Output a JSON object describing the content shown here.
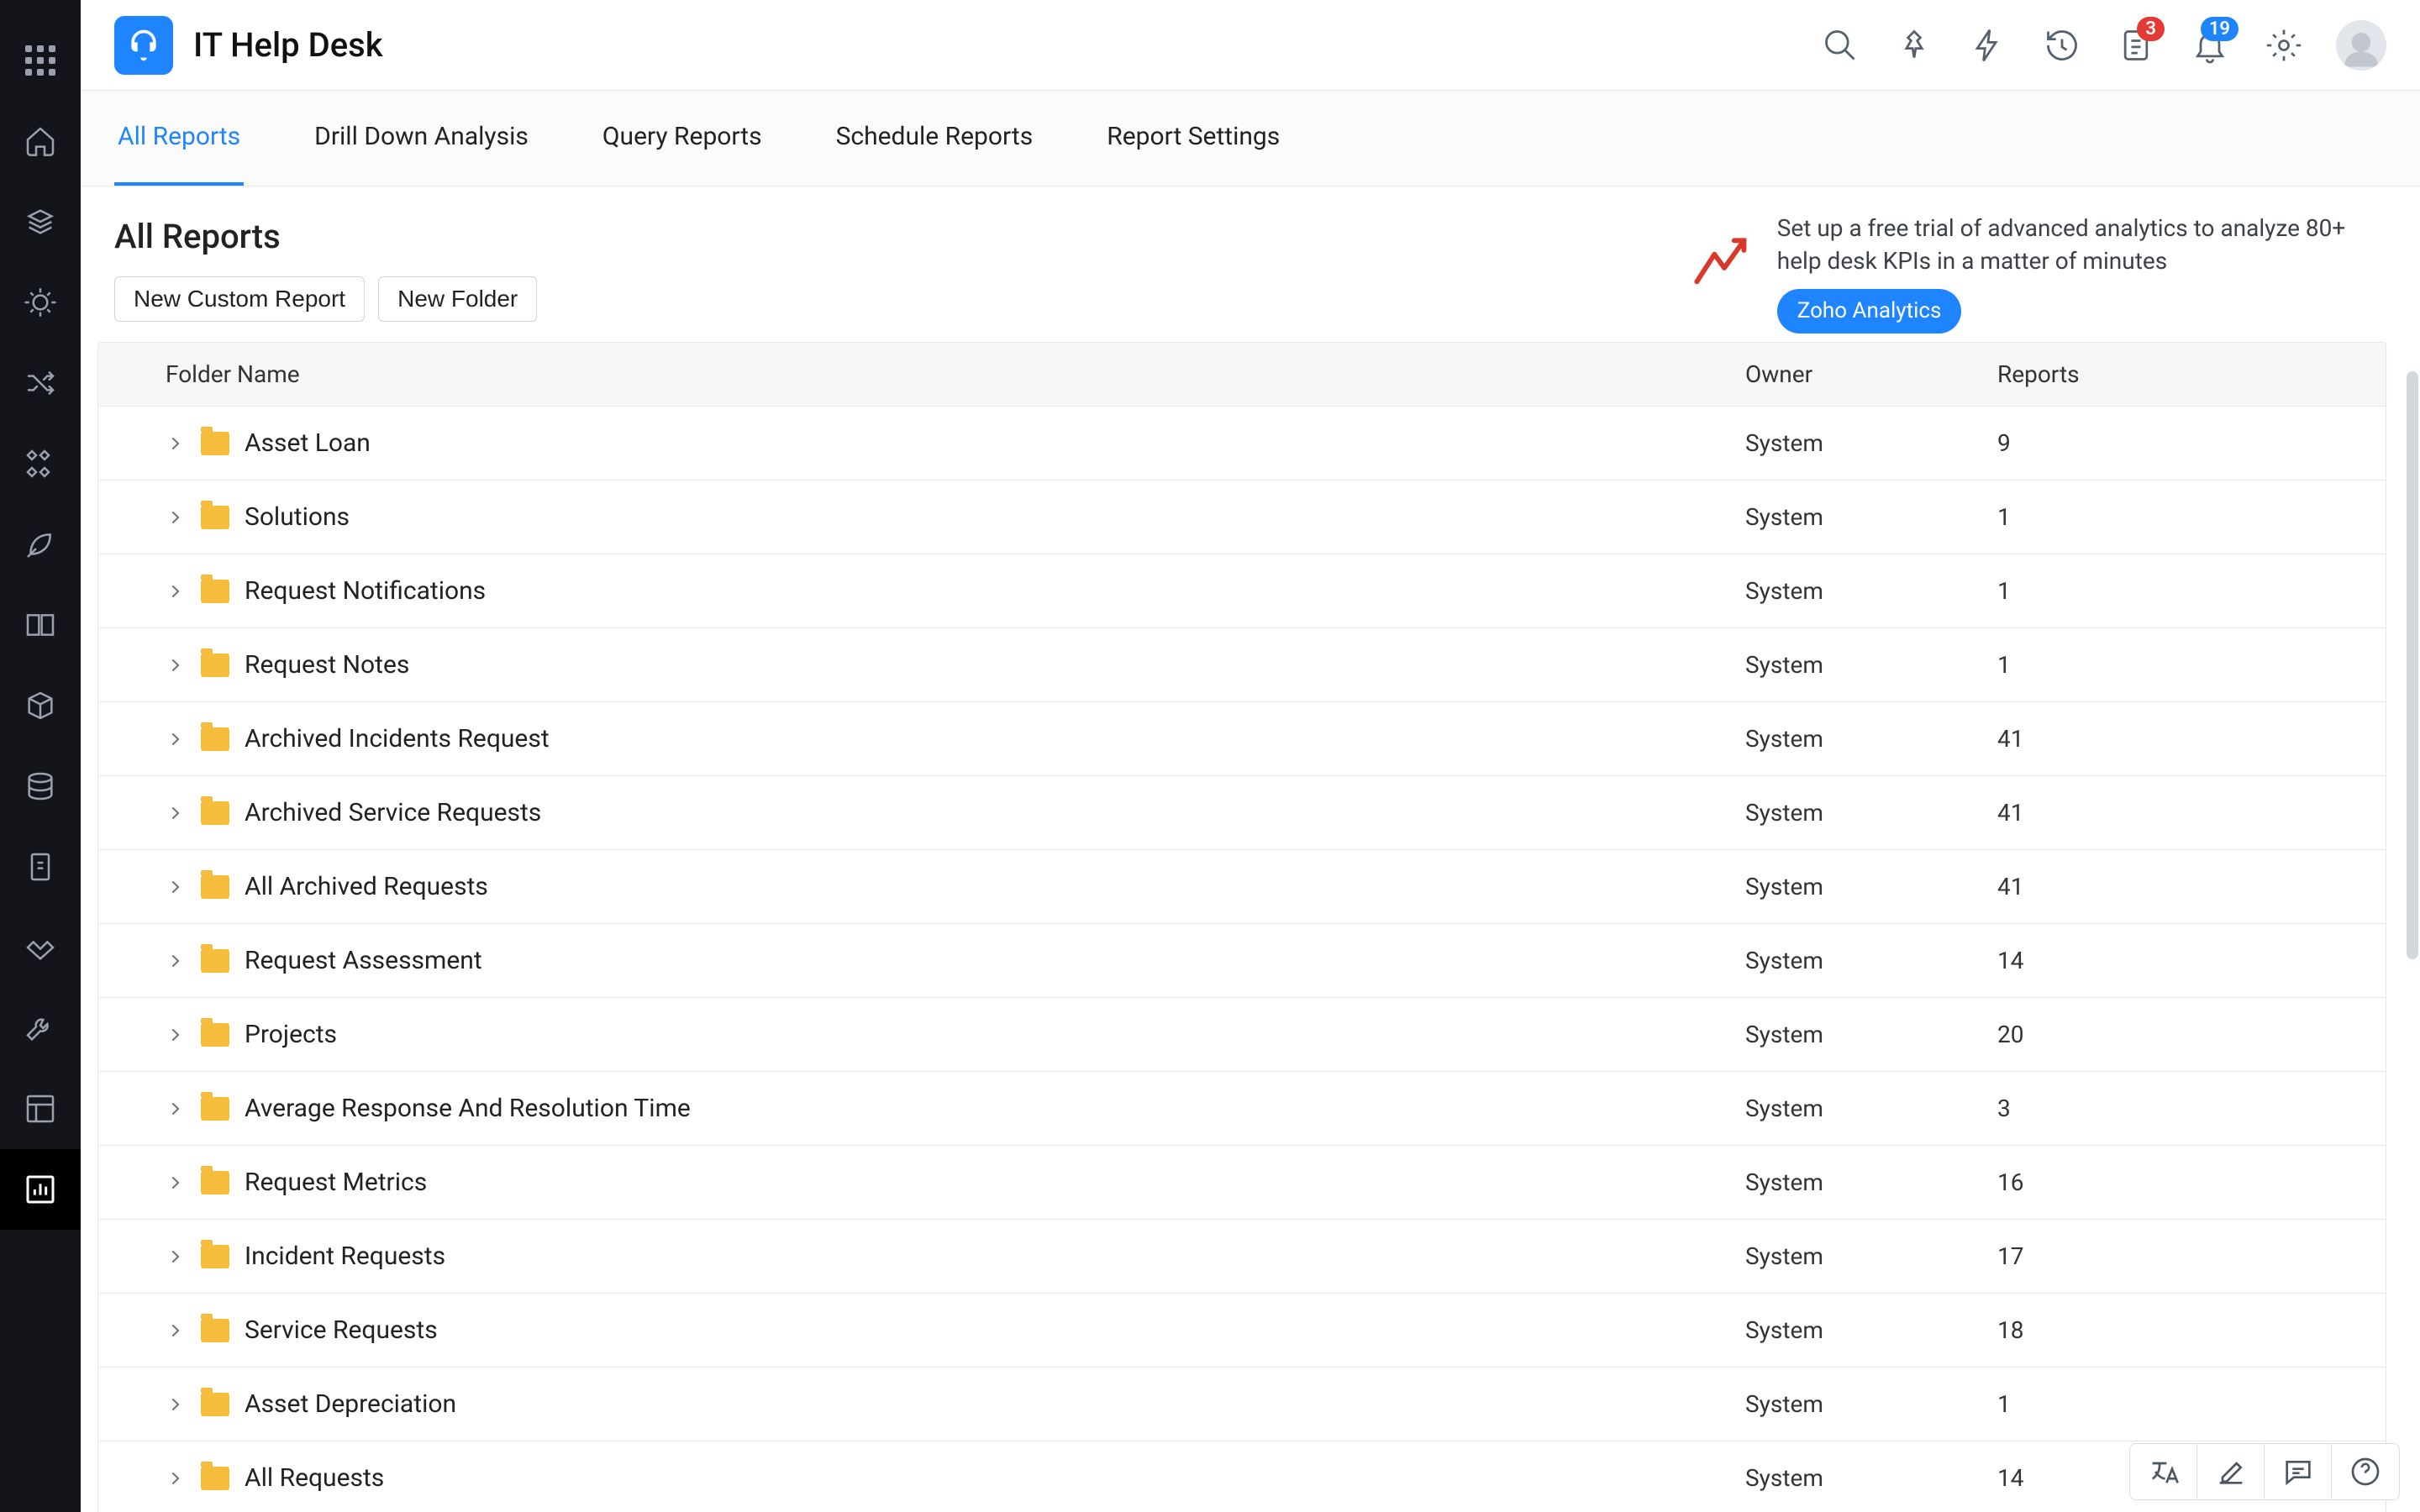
{
  "app": {
    "title": "IT Help Desk"
  },
  "header": {
    "badge_tasks": "3",
    "badge_notifications": "19"
  },
  "tabs": [
    {
      "label": "All Reports",
      "active": true
    },
    {
      "label": "Drill Down Analysis",
      "active": false
    },
    {
      "label": "Query Reports",
      "active": false
    },
    {
      "label": "Schedule Reports",
      "active": false
    },
    {
      "label": "Report Settings",
      "active": false
    }
  ],
  "page": {
    "heading": "All Reports",
    "btn_new_report": "New Custom Report",
    "btn_new_folder": "New Folder"
  },
  "promo": {
    "text": "Set up a free trial of advanced analytics to analyze 80+ help desk KPIs in a matter of minutes",
    "cta": "Zoho Analytics"
  },
  "table": {
    "columns": {
      "folder": "Folder Name",
      "owner": "Owner",
      "reports": "Reports"
    },
    "rows": [
      {
        "name": "Asset Loan",
        "owner": "System",
        "reports": "9"
      },
      {
        "name": "Solutions",
        "owner": "System",
        "reports": "1"
      },
      {
        "name": "Request Notifications",
        "owner": "System",
        "reports": "1"
      },
      {
        "name": "Request Notes",
        "owner": "System",
        "reports": "1"
      },
      {
        "name": "Archived Incidents Request",
        "owner": "System",
        "reports": "41"
      },
      {
        "name": "Archived Service Requests",
        "owner": "System",
        "reports": "41"
      },
      {
        "name": "All Archived Requests",
        "owner": "System",
        "reports": "41"
      },
      {
        "name": "Request Assessment",
        "owner": "System",
        "reports": "14"
      },
      {
        "name": "Projects",
        "owner": "System",
        "reports": "20"
      },
      {
        "name": "Average Response And Resolution Time",
        "owner": "System",
        "reports": "3"
      },
      {
        "name": "Request Metrics",
        "owner": "System",
        "reports": "16"
      },
      {
        "name": "Incident Requests",
        "owner": "System",
        "reports": "17"
      },
      {
        "name": "Service Requests",
        "owner": "System",
        "reports": "18"
      },
      {
        "name": "Asset Depreciation",
        "owner": "System",
        "reports": "1"
      },
      {
        "name": "All Requests",
        "owner": "System",
        "reports": "14"
      }
    ]
  }
}
